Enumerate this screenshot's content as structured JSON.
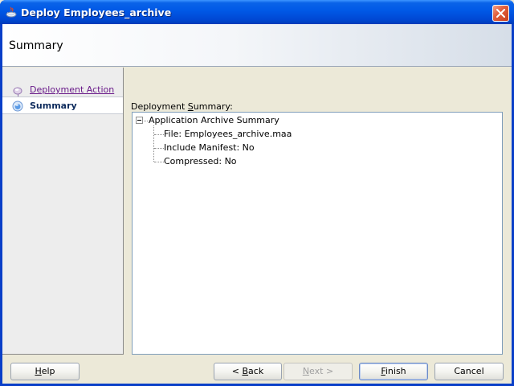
{
  "window": {
    "title": "Deploy Employees_archive",
    "title_icon": "coffee-cup-icon",
    "close_icon": "close-icon"
  },
  "header": {
    "title": "Summary"
  },
  "nav": {
    "items": [
      {
        "label": "Deployment Action",
        "state": "visited",
        "icon": "step-dot-icon"
      },
      {
        "label": "Summary",
        "state": "current",
        "icon": "step-current-icon"
      }
    ]
  },
  "content": {
    "label_prefix": "Deployment ",
    "label_mnemonic": "S",
    "label_suffix": "ummary:",
    "tree": {
      "root": "Application Archive Summary",
      "children": [
        "File:  Employees_archive.maa",
        "Include Manifest:  No",
        "Compressed:  No"
      ]
    }
  },
  "footer": {
    "help": {
      "mn": "H",
      "rest": "elp"
    },
    "back": {
      "prefix": "< ",
      "mn": "B",
      "rest": "ack"
    },
    "next": {
      "mn": "N",
      "rest": "ext >"
    },
    "finish": {
      "mn": "F",
      "rest": "inish"
    },
    "cancel": {
      "label": "Cancel"
    }
  },
  "colors": {
    "titlebar": "#0058e6",
    "accent_link": "#6a1b8a",
    "current_step": "#0d2a5c"
  }
}
